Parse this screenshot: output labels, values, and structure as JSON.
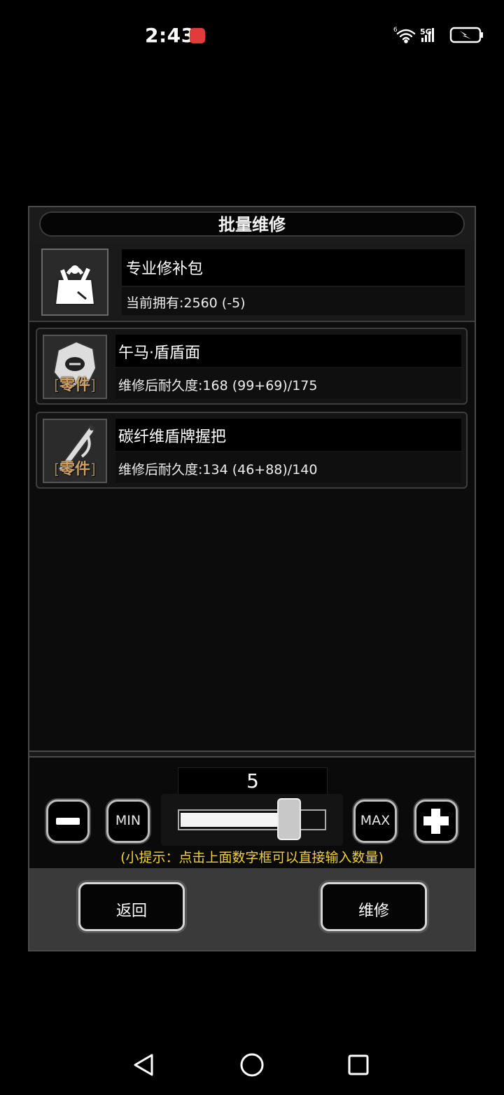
{
  "status_bar": {
    "time": "2:43",
    "network": "5G",
    "wifi_badge": "6",
    "icons": [
      "app-notification-icon",
      "wifi-icon",
      "signal-icon",
      "battery-charging-icon"
    ]
  },
  "dialog": {
    "title": "批量维修",
    "kit": {
      "name": "专业修补包",
      "owned": "当前拥有:2560 (-5)",
      "icon": "toolbox-icon"
    },
    "items": [
      {
        "name": "午马·盾盾面",
        "durability": "维修后耐久度:168 (99+69)/175",
        "tag": "零件",
        "icon": "shield-face-icon"
      },
      {
        "name": "碳纤维盾牌握把",
        "durability": "维修后耐久度:134 (46+88)/140",
        "tag": "零件",
        "icon": "shield-grip-icon"
      }
    ],
    "quantity": "5",
    "slider_fraction": 0.8,
    "min_label": "MIN",
    "max_label": "MAX",
    "tip": "(小提示：点击上面数字框可以直接输入数量)",
    "back_label": "返回",
    "repair_label": "维修"
  },
  "nav_bar": {
    "icons": [
      "back-triangle-icon",
      "home-circle-icon",
      "recents-square-icon"
    ]
  }
}
